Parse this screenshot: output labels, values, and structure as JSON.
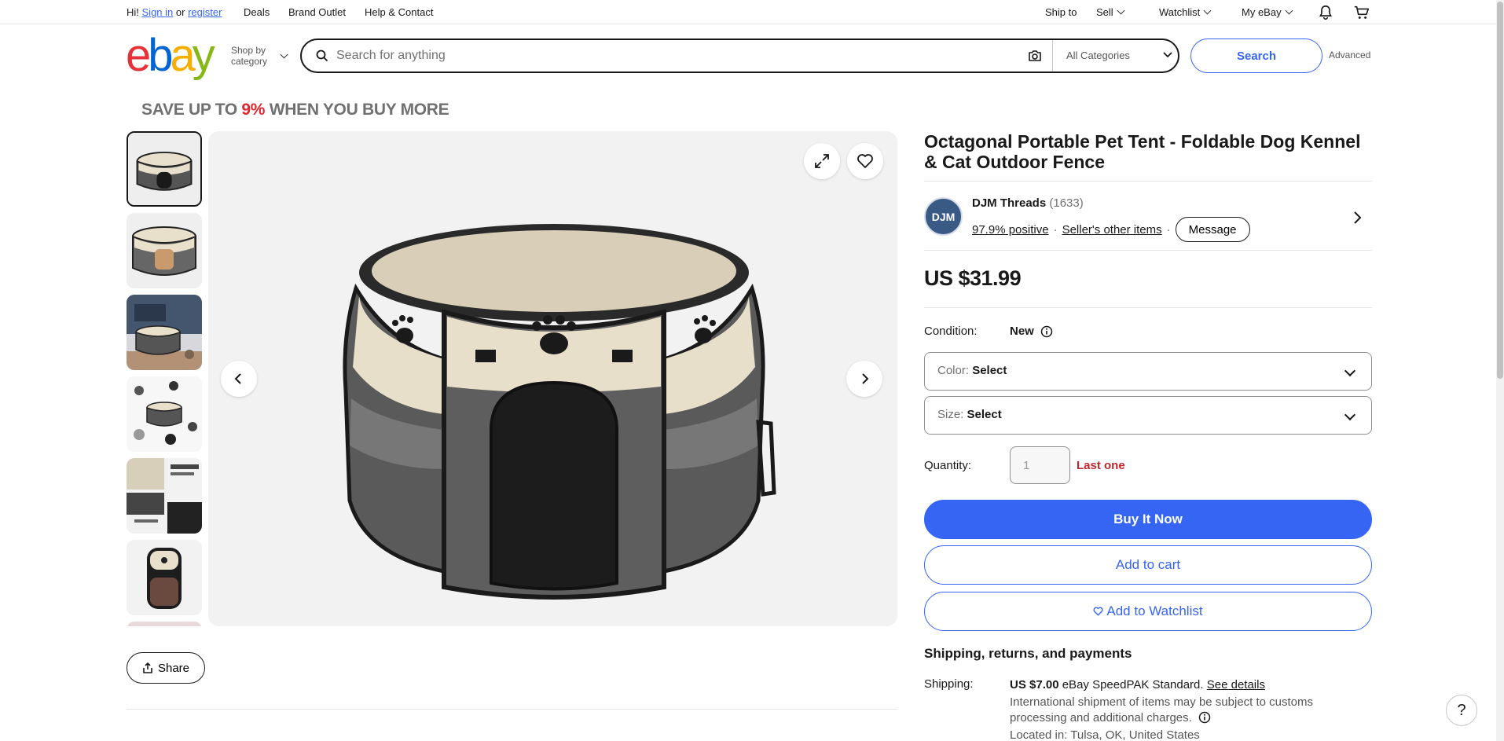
{
  "topnav": {
    "greeting": "Hi!",
    "sign_in": "Sign in",
    "or": "or",
    "register": "register",
    "deals": "Deals",
    "brand_outlet": "Brand Outlet",
    "help_contact": "Help & Contact",
    "ship_to": "Ship to",
    "sell": "Sell",
    "watchlist": "Watchlist",
    "my_ebay": "My eBay"
  },
  "header": {
    "logo_letters": [
      "e",
      "b",
      "a",
      "y"
    ],
    "shop_by_line1": "Shop by",
    "shop_by_line2": "category",
    "search_placeholder": "Search for anything",
    "category": "All Categories",
    "search_button": "Search",
    "advanced": "Advanced"
  },
  "promo": {
    "prefix": "SAVE UP TO ",
    "highlight": "9%",
    "suffix": " WHEN YOU BUY MORE",
    "highlight_color": "#e0272f"
  },
  "gallery": {
    "share_label": "Share"
  },
  "product": {
    "title": "Octagonal Portable Pet Tent - Foldable Dog Kennel & Cat Outdoor Fence",
    "seller": {
      "avatar_text": "DJM",
      "name": "DJM Threads",
      "count": "(1633)",
      "positive": "97.9% positive",
      "dot": "·",
      "other_items": "Seller's other items",
      "message": "Message"
    },
    "price": "US $31.99",
    "condition_label": "Condition:",
    "condition_value": "New",
    "color_label": "Color:",
    "color_value": "Select",
    "size_label": "Size:",
    "size_value": "Select",
    "quantity_label": "Quantity:",
    "quantity_value": "1",
    "quantity_note": "Last one",
    "buy_now": "Buy It Now",
    "add_to_cart": "Add to cart",
    "add_to_watchlist": "Add to Watchlist"
  },
  "shipping": {
    "heading": "Shipping, returns, and payments",
    "label": "Shipping:",
    "price": "US $7.00",
    "service": "eBay SpeedPAK Standard.",
    "details_link": "See details",
    "note": "International shipment of items may be subject to customs processing and additional charges.",
    "located": "Located in: Tulsa, OK, United States"
  },
  "colors": {
    "accent": "#3665f3",
    "alert": "#c0272d"
  }
}
